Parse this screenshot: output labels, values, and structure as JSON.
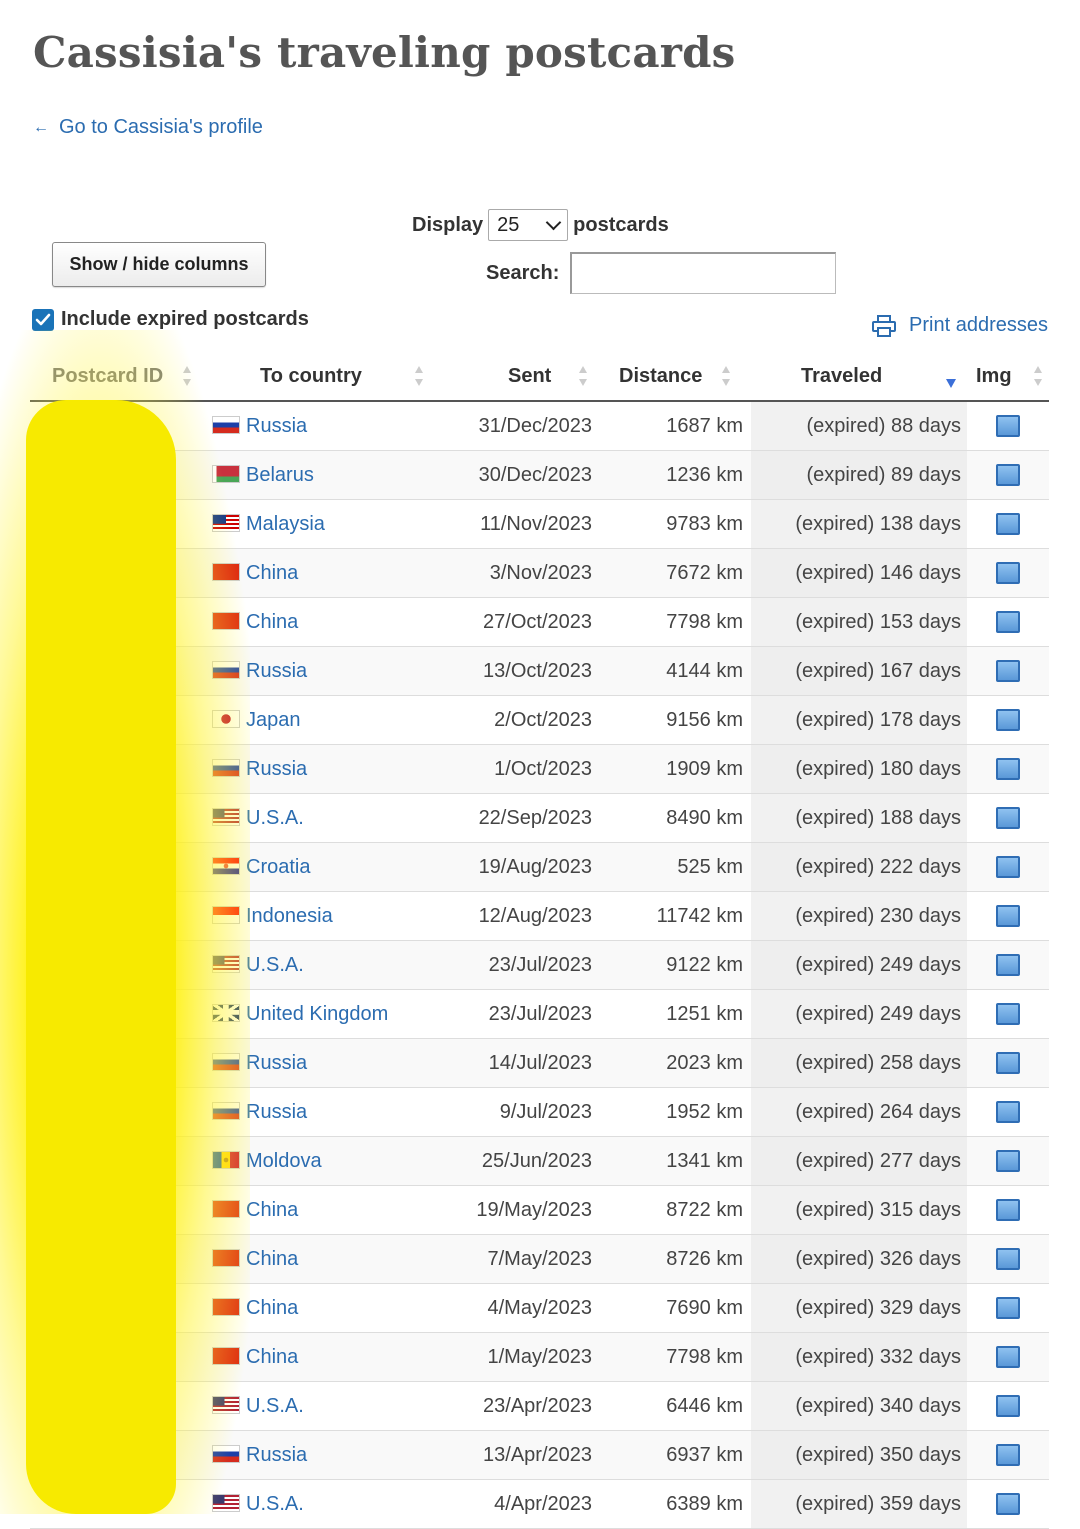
{
  "page": {
    "title": "Cassisia's traveling postcards",
    "profile_link": "Go to Cassisia's profile"
  },
  "controls": {
    "display_label": "Display",
    "display_value": "25",
    "display_suffix": "postcards",
    "show_hide_label": "Show / hide columns",
    "search_label": "Search:",
    "search_value": "",
    "include_expired_label": "Include expired postcards",
    "include_expired_checked": true,
    "print_label": "Print addresses"
  },
  "table": {
    "headers": {
      "id": "Postcard ID",
      "country": "To country",
      "sent": "Sent",
      "distance": "Distance",
      "traveled": "Traveled",
      "img": "Img"
    },
    "sorted_column": "traveled",
    "rows": [
      {
        "country": "Russia",
        "flag": "russia-flag",
        "sent": "31/Dec/2023",
        "distance": "1687 km",
        "traveled": "(expired) 88 days"
      },
      {
        "country": "Belarus",
        "flag": "belarus-flag",
        "sent": "30/Dec/2023",
        "distance": "1236 km",
        "traveled": "(expired) 89 days"
      },
      {
        "country": "Malaysia",
        "flag": "malaysia-flag",
        "sent": "11/Nov/2023",
        "distance": "9783 km",
        "traveled": "(expired) 138 days"
      },
      {
        "country": "China",
        "flag": "china-flag",
        "sent": "3/Nov/2023",
        "distance": "7672 km",
        "traveled": "(expired) 146 days"
      },
      {
        "country": "China",
        "flag": "china-flag",
        "sent": "27/Oct/2023",
        "distance": "7798 km",
        "traveled": "(expired) 153 days"
      },
      {
        "country": "Russia",
        "flag": "russia-flag",
        "sent": "13/Oct/2023",
        "distance": "4144 km",
        "traveled": "(expired) 167 days"
      },
      {
        "country": "Japan",
        "flag": "japan-flag",
        "sent": "2/Oct/2023",
        "distance": "9156 km",
        "traveled": "(expired) 178 days"
      },
      {
        "country": "Russia",
        "flag": "russia-flag",
        "sent": "1/Oct/2023",
        "distance": "1909 km",
        "traveled": "(expired) 180 days"
      },
      {
        "country": "U.S.A.",
        "flag": "usa-flag",
        "sent": "22/Sep/2023",
        "distance": "8490 km",
        "traveled": "(expired) 188 days"
      },
      {
        "country": "Croatia",
        "flag": "croatia-flag",
        "sent": "19/Aug/2023",
        "distance": "525 km",
        "traveled": "(expired) 222 days"
      },
      {
        "country": "Indonesia",
        "flag": "indonesia-flag",
        "sent": "12/Aug/2023",
        "distance": "11742 km",
        "traveled": "(expired) 230 days"
      },
      {
        "country": "U.S.A.",
        "flag": "usa-flag",
        "sent": "23/Jul/2023",
        "distance": "9122 km",
        "traveled": "(expired) 249 days"
      },
      {
        "country": "United Kingdom",
        "flag": "uk-flag",
        "sent": "23/Jul/2023",
        "distance": "1251 km",
        "traveled": "(expired) 249 days"
      },
      {
        "country": "Russia",
        "flag": "russia-flag",
        "sent": "14/Jul/2023",
        "distance": "2023 km",
        "traveled": "(expired) 258 days"
      },
      {
        "country": "Russia",
        "flag": "russia-flag",
        "sent": "9/Jul/2023",
        "distance": "1952 km",
        "traveled": "(expired) 264 days"
      },
      {
        "country": "Moldova",
        "flag": "moldova-flag",
        "sent": "25/Jun/2023",
        "distance": "1341 km",
        "traveled": "(expired) 277 days"
      },
      {
        "country": "China",
        "flag": "china-flag",
        "sent": "19/May/2023",
        "distance": "8722 km",
        "traveled": "(expired) 315 days"
      },
      {
        "country": "China",
        "flag": "china-flag",
        "sent": "7/May/2023",
        "distance": "8726 km",
        "traveled": "(expired) 326 days"
      },
      {
        "country": "China",
        "flag": "china-flag",
        "sent": "4/May/2023",
        "distance": "7690 km",
        "traveled": "(expired) 329 days"
      },
      {
        "country": "China",
        "flag": "china-flag",
        "sent": "1/May/2023",
        "distance": "7798 km",
        "traveled": "(expired) 332 days"
      },
      {
        "country": "U.S.A.",
        "flag": "usa-flag",
        "sent": "23/Apr/2023",
        "distance": "6446 km",
        "traveled": "(expired) 340 days"
      },
      {
        "country": "Russia",
        "flag": "russia-flag",
        "sent": "13/Apr/2023",
        "distance": "6937 km",
        "traveled": "(expired) 350 days"
      },
      {
        "country": "U.S.A.",
        "flag": "usa-flag",
        "sent": "4/Apr/2023",
        "distance": "6389 km",
        "traveled": "(expired) 359 days"
      }
    ]
  },
  "colors": {
    "link": "#2b6cb0",
    "highlighter": "#f7ea00",
    "sort_active": "#3b6fd8",
    "sort_inactive": "#cccccc"
  }
}
